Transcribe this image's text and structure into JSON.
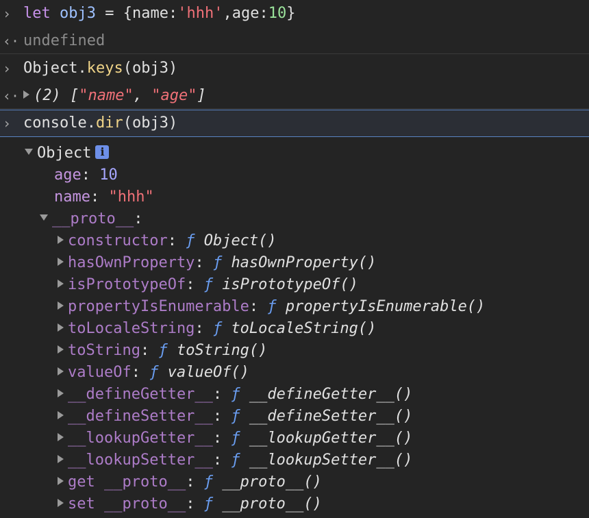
{
  "console": {
    "entry1": {
      "input": {
        "kw": "let",
        "var": "obj3",
        "eq": " = ",
        "open": "{",
        "k1": "name",
        "colon1": ":",
        "v1": "'hhh'",
        "comma": ",",
        "k2": "age",
        "colon2": ":",
        "v2": "10",
        "close": "}"
      },
      "result": "undefined"
    },
    "entry2": {
      "input": {
        "obj": "Object",
        "dot": ".",
        "fn": "keys",
        "open": "(",
        "arg": "obj3",
        "close": ")"
      },
      "result": {
        "count": "(2)",
        "open": " [",
        "s1": "\"name\"",
        "sep": ", ",
        "s2": "\"age\"",
        "close": "]"
      }
    },
    "entry3": {
      "input": {
        "obj": "console",
        "dot": ".",
        "fn": "dir",
        "open": "(",
        "arg": "obj3",
        "close": ")"
      }
    },
    "tree": {
      "root_label": "Object",
      "info_badge": "i",
      "own_props": [
        {
          "key": "age",
          "sep": ": ",
          "value": "10",
          "type": "num"
        },
        {
          "key": "name",
          "sep": ": ",
          "value": "\"hhh\"",
          "type": "str"
        }
      ],
      "proto_label": "__proto__",
      "proto_colon": ":",
      "proto_items": [
        {
          "key": "constructor",
          "sep": ": ",
          "f": "ƒ",
          "fn": "Object()"
        },
        {
          "key": "hasOwnProperty",
          "sep": ": ",
          "f": "ƒ",
          "fn": "hasOwnProperty()"
        },
        {
          "key": "isPrototypeOf",
          "sep": ": ",
          "f": "ƒ",
          "fn": "isPrototypeOf()"
        },
        {
          "key": "propertyIsEnumerable",
          "sep": ": ",
          "f": "ƒ",
          "fn": "propertyIsEnumerable()"
        },
        {
          "key": "toLocaleString",
          "sep": ": ",
          "f": "ƒ",
          "fn": "toLocaleString()"
        },
        {
          "key": "toString",
          "sep": ": ",
          "f": "ƒ",
          "fn": "toString()"
        },
        {
          "key": "valueOf",
          "sep": ": ",
          "f": "ƒ",
          "fn": "valueOf()"
        },
        {
          "key": "__defineGetter__",
          "sep": ": ",
          "f": "ƒ",
          "fn": "__defineGetter__()"
        },
        {
          "key": "__defineSetter__",
          "sep": ": ",
          "f": "ƒ",
          "fn": "__defineSetter__()"
        },
        {
          "key": "__lookupGetter__",
          "sep": ": ",
          "f": "ƒ",
          "fn": "__lookupGetter__()"
        },
        {
          "key": "__lookupSetter__",
          "sep": ": ",
          "f": "ƒ",
          "fn": "__lookupSetter__()"
        },
        {
          "key": "get __proto__",
          "sep": ": ",
          "f": "ƒ",
          "fn": "__proto__()"
        },
        {
          "key": "set __proto__",
          "sep": ": ",
          "f": "ƒ",
          "fn": "__proto__()"
        }
      ]
    },
    "glyphs": {
      "prompt": "›",
      "return": "‹·"
    }
  },
  "colors": {
    "background": "#242424",
    "keyword": "#c792ea",
    "string": "#f07178",
    "number": "#a6a6ff",
    "function_name": "#f0d488",
    "property": "#c595e0",
    "active_border": "#5a84c3"
  }
}
